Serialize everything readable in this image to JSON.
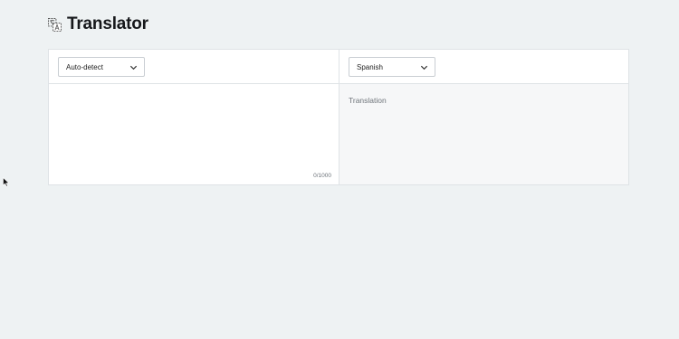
{
  "app": {
    "title": "Translator",
    "logo_icon": "translate-icon"
  },
  "source": {
    "language_selected": "Auto-detect",
    "text_value": "",
    "char_count": "0/1000"
  },
  "target": {
    "language_selected": "Spanish",
    "translation_placeholder": "Translation"
  },
  "colors": {
    "background": "#eef2f3",
    "panel": "#ffffff",
    "border": "#dfe3e6",
    "target_background": "#f6f7f8"
  }
}
